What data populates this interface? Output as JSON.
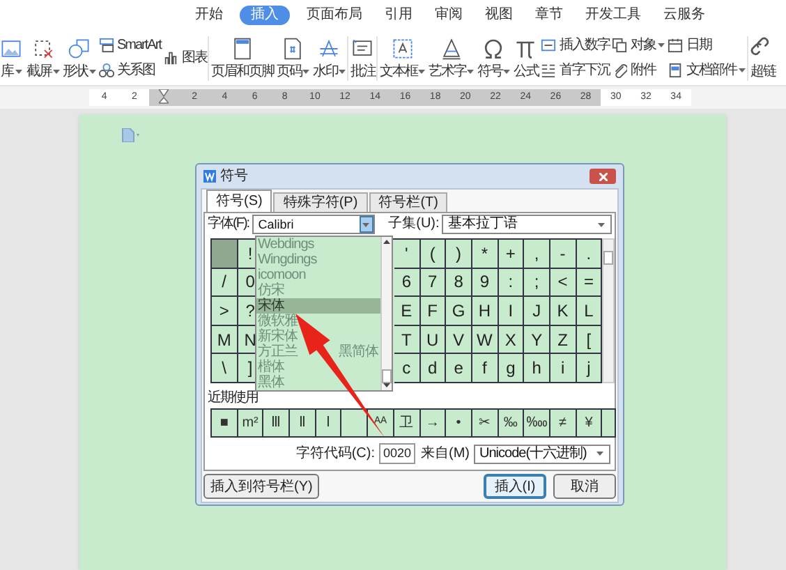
{
  "menu_tabs": [
    {
      "label": "开始",
      "selected": false
    },
    {
      "label": "插入",
      "selected": true
    },
    {
      "label": "页面布局",
      "selected": false
    },
    {
      "label": "引用",
      "selected": false
    },
    {
      "label": "审阅",
      "selected": false
    },
    {
      "label": "视图",
      "selected": false
    },
    {
      "label": "章节",
      "selected": false
    },
    {
      "label": "开发工具",
      "selected": false
    },
    {
      "label": "云服务",
      "selected": false
    }
  ],
  "ribbon": [
    {
      "kind": "big",
      "label": "库",
      "caret": true
    },
    {
      "kind": "big",
      "label": "截屏",
      "caret": true
    },
    {
      "kind": "big",
      "label": "形状",
      "caret": true
    },
    {
      "kind": "stack",
      "items": [
        {
          "label": "SmartArt",
          "caret": false
        },
        {
          "label": "关系图",
          "caret": false
        }
      ]
    },
    {
      "kind": "stack",
      "items": [
        {
          "label": "图表",
          "caret": false
        }
      ]
    },
    {
      "kind": "sep"
    },
    {
      "kind": "big",
      "label": "页眉和页脚",
      "caret": false
    },
    {
      "kind": "big",
      "label": "页码",
      "caret": true
    },
    {
      "kind": "big",
      "label": "水印",
      "caret": true
    },
    {
      "kind": "sep"
    },
    {
      "kind": "big",
      "label": "批注",
      "caret": false
    },
    {
      "kind": "sep"
    },
    {
      "kind": "big",
      "label": "文本框",
      "caret": true
    },
    {
      "kind": "big",
      "label": "艺术字",
      "caret": true
    },
    {
      "kind": "big",
      "label": "符号",
      "caret": true
    },
    {
      "kind": "big",
      "label": "公式",
      "caret": false
    },
    {
      "kind": "stack",
      "items": [
        {
          "label": "插入数字",
          "caret": false
        },
        {
          "label": "首字下沉",
          "caret": false
        }
      ]
    },
    {
      "kind": "stack",
      "items": [
        {
          "label": "对象",
          "caret": true
        },
        {
          "label": "附件",
          "caret": false
        }
      ]
    },
    {
      "kind": "stack",
      "items": [
        {
          "label": "日期",
          "caret": false
        },
        {
          "label": "文档部件",
          "caret": true
        }
      ]
    },
    {
      "kind": "sep"
    },
    {
      "kind": "big",
      "label": "超链",
      "caret": false
    }
  ],
  "ruler": {
    "left_labels": [
      "4",
      "2"
    ],
    "right_labels": [
      "2",
      "4",
      "6",
      "8",
      "10",
      "12",
      "14",
      "16",
      "18",
      "20",
      "22",
      "24",
      "26",
      "28",
      "30",
      "32",
      "34"
    ]
  },
  "dialog": {
    "title": "符号",
    "tabs": [
      {
        "label": "符号(S)",
        "selected": true
      },
      {
        "label": "特殊字符(P)",
        "selected": false
      },
      {
        "label": "符号栏(T)",
        "selected": false
      }
    ],
    "font_label": "字体(F):",
    "font_value": "Calibri",
    "subset_label": "子集(U):",
    "subset_value": "基本拉丁语",
    "grid_rows": [
      {
        "first_selected": true,
        "second": "!",
        "chars": [
          "'",
          "(",
          ")",
          "*",
          "+",
          ",",
          "-",
          "."
        ]
      },
      {
        "first": "/",
        "first_selected": false,
        "second": "0",
        "chars": [
          "6",
          "7",
          "8",
          "9",
          ":",
          ";",
          "<",
          "="
        ]
      },
      {
        "first": ">",
        "first_selected": false,
        "second": "?",
        "chars": [
          "E",
          "F",
          "G",
          "H",
          "I",
          "J",
          "K",
          "L"
        ]
      },
      {
        "first": "M",
        "first_selected": false,
        "second": "N",
        "chars": [
          "T",
          "U",
          "V",
          "W",
          "X",
          "Y",
          "Z",
          "["
        ]
      },
      {
        "first": "\\",
        "first_selected": false,
        "second": "]",
        "chars": [
          "c",
          "d",
          "e",
          "f",
          "g",
          "h",
          "i",
          "j"
        ]
      }
    ],
    "font_list": [
      {
        "label": "Webdings",
        "selected": false
      },
      {
        "label": "Wingdings",
        "selected": false
      },
      {
        "label": "icomoon",
        "selected": false
      },
      {
        "label": "仿宋",
        "selected": false
      },
      {
        "label": "宋体",
        "selected": true
      },
      {
        "label": "微软雅",
        "selected": false
      },
      {
        "label": "新宋体",
        "selected": false
      },
      {
        "parts": [
          "方正兰",
          "黑简体"
        ],
        "selected": false
      },
      {
        "label": "楷体",
        "selected": false
      },
      {
        "label": "黑体",
        "selected": false
      }
    ],
    "recent_label": "近期使用",
    "recent": [
      {
        "kind": "symbol",
        "char": "■"
      },
      {
        "kind": "symbol",
        "char": "m²"
      },
      {
        "kind": "symbol",
        "char": "Ⅲ"
      },
      {
        "kind": "symbol",
        "char": "Ⅱ"
      },
      {
        "kind": "symbol",
        "char": "Ⅰ"
      },
      {
        "kind": "blank"
      },
      {
        "kind": "symbol",
        "char": "ᴬᴬ"
      },
      {
        "kind": "symbol",
        "char": "卫"
      },
      {
        "kind": "symbol",
        "char": "→"
      },
      {
        "kind": "symbol",
        "char": "•"
      },
      {
        "kind": "symbol",
        "char": "✂"
      },
      {
        "kind": "symbol",
        "char": "‰"
      },
      {
        "kind": "symbol",
        "char": "‱"
      },
      {
        "kind": "symbol",
        "char": "≠"
      },
      {
        "kind": "symbol",
        "char": "¥"
      }
    ],
    "code_label": "字符代码(C):",
    "code_value": "0020",
    "from_label": "来自(M)",
    "from_value": "Unicode(十六进制)",
    "buttons": [
      {
        "label": "插入到符号栏(Y)",
        "kind": "left"
      },
      {
        "label": "插入(I)",
        "kind": "default"
      },
      {
        "label": "取消",
        "kind": "normal"
      }
    ]
  },
  "annotation": {
    "kind": "arrow"
  }
}
